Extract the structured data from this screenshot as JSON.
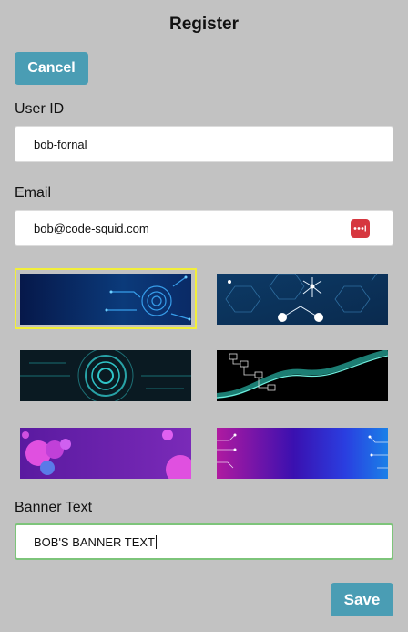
{
  "header": {
    "title": "Register"
  },
  "actions": {
    "cancel_label": "Cancel",
    "save_label": "Save"
  },
  "form": {
    "user_id": {
      "label": "User ID",
      "value": "bob-fornal"
    },
    "email": {
      "label": "Email",
      "value": "bob@code-squid.com",
      "autofill_icon": "password-manager-icon"
    },
    "banner_text": {
      "label": "Banner Text",
      "value": "BOB'S BANNER TEXT"
    }
  },
  "banners": {
    "selected_index": 0,
    "items": [
      {
        "name": "blue-circuit-gear",
        "accent": "#2a8be0"
      },
      {
        "name": "hexagon-network",
        "accent": "#3aa0d8"
      },
      {
        "name": "teal-concentric-rings",
        "accent": "#2fc4c8"
      },
      {
        "name": "teal-wave-flowchart",
        "accent": "#2fd0c0"
      },
      {
        "name": "purple-bubbles",
        "accent": "#c040d8"
      },
      {
        "name": "blue-purple-gradient",
        "accent": "#2a3ee0"
      }
    ]
  },
  "colors": {
    "primary_button": "#4a9db4",
    "selected_border": "#f2ef3a",
    "focused_border": "#7dc47a",
    "background": "#c2c2c2"
  }
}
